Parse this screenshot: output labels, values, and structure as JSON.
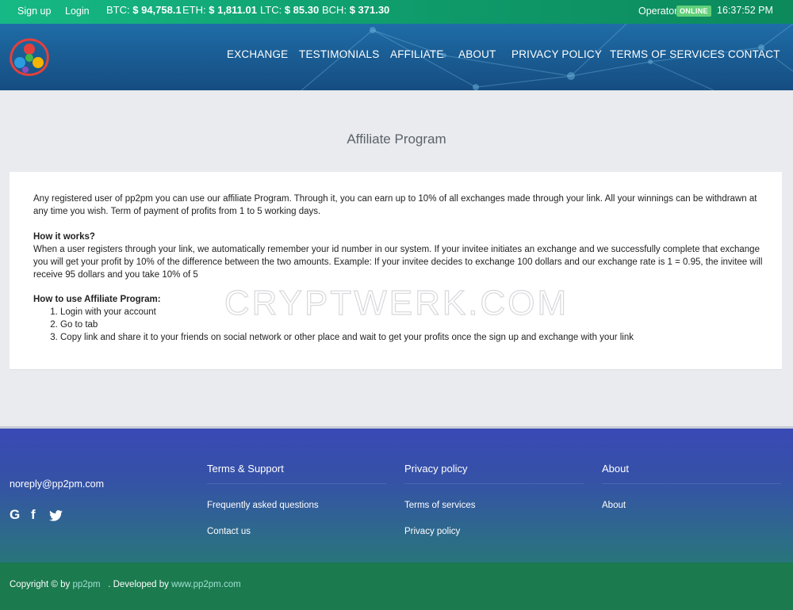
{
  "topbar": {
    "signup": "Sign up",
    "login": "Login",
    "btc_label": "BTC:",
    "btc_value": "$ 94,758.1",
    "eth_label": "ETH:",
    "eth_value": "$ 1,811.01",
    "ltc_label": "LTC:",
    "ltc_value": "$ 85.30",
    "bch_label": "BCH:",
    "bch_value": "$ 371.30",
    "operator_label": "Operator:",
    "operator_status": "ONLINE",
    "time": "16:37:52 PM"
  },
  "nav": {
    "exchange": "EXCHANGE",
    "testimonials": "TESTIMONIALS",
    "affiliate": "AFFILIATE",
    "about": "ABOUT",
    "privacy": "PRIVACY POLICY",
    "terms": "TERMS OF SERVICES",
    "contact": "CONTACT"
  },
  "page": {
    "title": "Affiliate Program",
    "intro": "Any registered user of pp2pm you can use our affiliate Program. Through it, you can earn up to 10% of all exchanges made through your link. All your winnings can be withdrawn at any time you wish. Term of payment of profits from 1 to 5 working days.",
    "how_heading": "How it works?",
    "how_text": "When a user registers through your link, we automatically remember your id number in our system. If your invitee initiates an exchange and we successfully complete that exchange you will get your profit by 10% of the difference between the two amounts. Example: If your invitee decides to exchange 100 dollars and our exchange rate is 1 = 0.95, the invitee will receive 95 dollars and you take 10% of 5",
    "use_heading": "How to use Affiliate Program:",
    "steps": [
      "Login with your account",
      "Go to tab",
      "Copy link and share it to your friends on social network or other place and wait to get your profits once the sign up and exchange with your link"
    ]
  },
  "watermark": "CRYPTWERK.COM",
  "footer": {
    "email": "noreply@pp2pm.com",
    "social": {
      "google": "G",
      "facebook": "f",
      "twitter": "twitter-icon"
    },
    "col1": {
      "heading": "Terms & Support",
      "links": [
        "Frequently asked questions",
        "Contact us"
      ]
    },
    "col2": {
      "heading": "Privacy policy",
      "links": [
        "Terms of services",
        "Privacy policy"
      ]
    },
    "col3": {
      "heading": "About",
      "links": [
        "About"
      ]
    },
    "copyright_prefix": "Copyright © by",
    "copyright_brand": "pp2pm",
    "developed_prefix": ". Developed by",
    "developed_link": "www.pp2pm.com"
  },
  "colors": {
    "topbar": "#16b985",
    "header": "#1a5e95",
    "online_badge": "#62d07a",
    "footer_top": "#3a49b6",
    "footer_bottom": "#1b7a4e"
  }
}
